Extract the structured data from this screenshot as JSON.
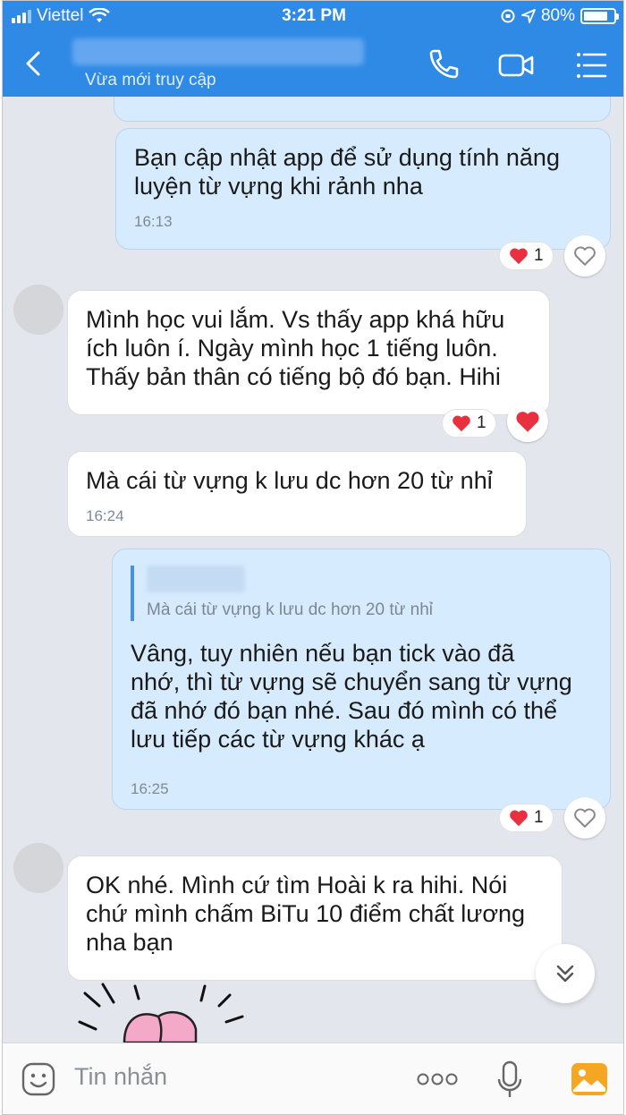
{
  "status": {
    "carrier": "Viettel",
    "time": "3:21 PM",
    "battery": "80%"
  },
  "header": {
    "subtitle": "Vừa mới truy cập"
  },
  "messages": [
    {
      "lines": [
        "Bạn cập nhật app để sử dụng tính năng",
        "luyện từ vựng khi rảnh nha"
      ],
      "time": "16:13",
      "reaction_count": "1"
    },
    {
      "lines": [
        "Mình học vui lắm. Vs thấy app khá hữu",
        "ích luôn í. Ngày mình học 1 tiếng luôn.",
        "Thấy bản thân có tiếng bộ đó bạn. Hihi"
      ],
      "reaction_count": "1"
    },
    {
      "lines": [
        "Mà cái từ vựng k lưu dc hơn 20 từ nhỉ"
      ],
      "time": "16:24"
    },
    {
      "quote": "Mà cái từ vựng k lưu dc hơn 20 từ nhỉ",
      "lines": [
        "Vâng, tuy nhiên nếu bạn tick vào đã",
        "nhớ, thì từ vựng sẽ chuyển sang từ vựng",
        "đã nhớ đó bạn nhé. Sau đó mình có thể",
        "lưu tiếp các từ vựng khác ạ"
      ],
      "time": "16:25",
      "reaction_count": "1"
    },
    {
      "lines": [
        "OK nhé. Mình cứ tìm Hoài k ra hihi. Nói",
        "chứ mình chấm BiTu 10 điểm chất lương",
        "nha bạn"
      ]
    }
  ],
  "input": {
    "placeholder": "Tin nhắn"
  },
  "icons": [
    "back-chevron",
    "phone",
    "video-camera",
    "menu-list",
    "heart",
    "chevron-double-down",
    "sticker-face",
    "more-dots",
    "microphone",
    "image-gallery"
  ],
  "colors": {
    "header": "#2f8ae6",
    "my_bubble": "#d6ebfd",
    "heart": "#e8303e",
    "gallery": "#f5a623"
  }
}
